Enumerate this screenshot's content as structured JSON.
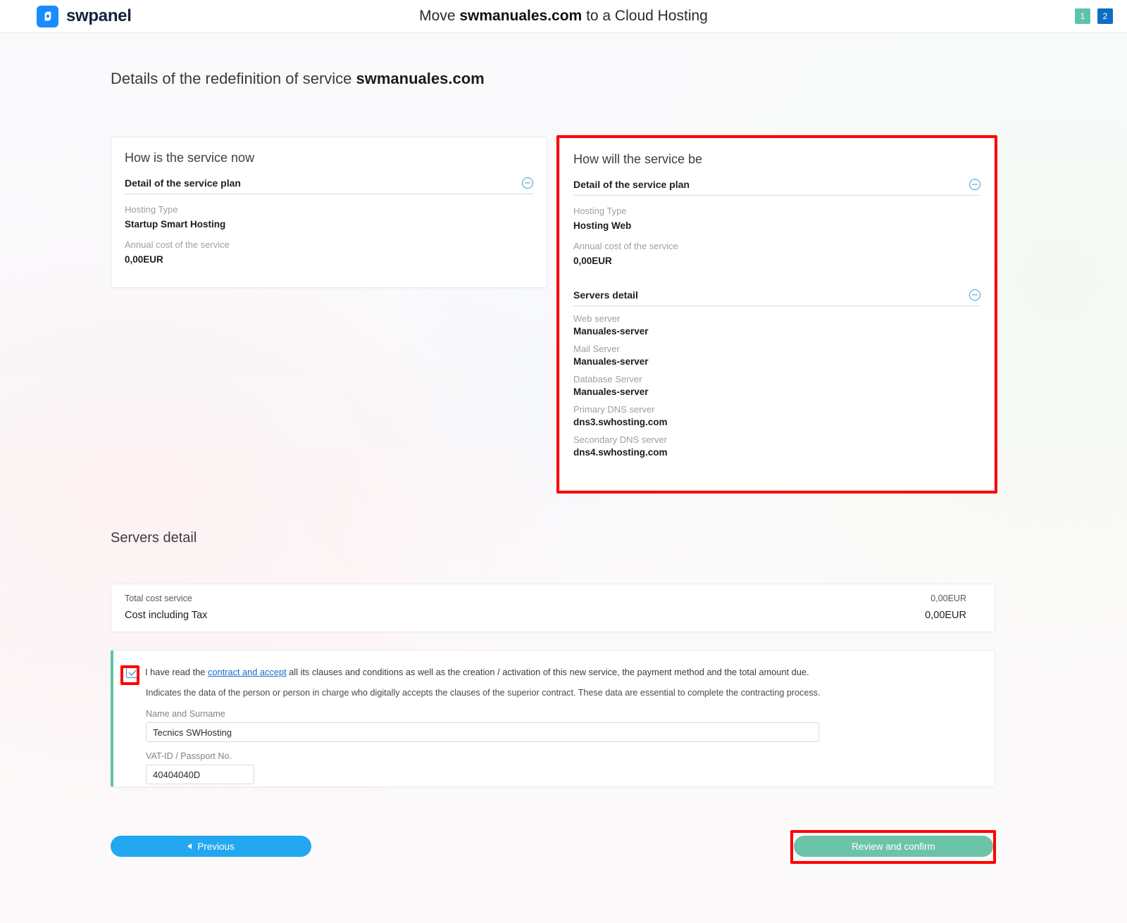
{
  "header": {
    "brand": "swpanel",
    "brand_icon": "swpanel-logo-icon",
    "title_prefix": "Move ",
    "title_domain": "swmanuales.com",
    "title_suffix": " to a Cloud Hosting",
    "steps": [
      {
        "label": "1",
        "state": "done",
        "color": "#5ec4a8"
      },
      {
        "label": "2",
        "state": "active",
        "color": "#0b6fc4"
      }
    ]
  },
  "page": {
    "title_prefix": "Details of the redefinition of service ",
    "title_domain": "swmanuales.com"
  },
  "service_now": {
    "heading": "How is the service now",
    "plan_section": {
      "title": "Detail of the service plan",
      "collapse_icon": "minus-circle-icon",
      "fields": [
        {
          "label": "Hosting Type",
          "value": "Startup Smart Hosting"
        },
        {
          "label": "Annual cost of the service",
          "value": "0,00EUR"
        }
      ]
    }
  },
  "service_next": {
    "heading": "How will the service be",
    "highlight_color": "#fe0000",
    "plan_section": {
      "title": "Detail of the service plan",
      "collapse_icon": "minus-circle-icon",
      "fields": [
        {
          "label": "Hosting Type",
          "value": "Hosting Web"
        },
        {
          "label": "Annual cost of the service",
          "value": "0,00EUR"
        }
      ]
    },
    "servers_section": {
      "title": "Servers detail",
      "collapse_icon": "minus-circle-icon",
      "fields": [
        {
          "label": "Web server",
          "value": "Manuales-server"
        },
        {
          "label": "Mail Server",
          "value": "Manuales-server"
        },
        {
          "label": "Database Server",
          "value": "Manuales-server"
        },
        {
          "label": "Primary DNS server",
          "value": "dns3.swhosting.com"
        },
        {
          "label": "Secondary DNS server",
          "value": "dns4.swhosting.com"
        }
      ]
    }
  },
  "servers_detail": {
    "heading": "Servers detail"
  },
  "cost": {
    "total_label": "Total cost service",
    "total_value": "0,00EUR",
    "tax_label": "Cost including Tax",
    "tax_value": "0,00EUR"
  },
  "contract": {
    "accent_color": "#5ec4a8",
    "checkbox_checked": true,
    "accept_text_before": "I have read the ",
    "accept_link": "contract and accept",
    "accept_text_after": " all its clauses and conditions as well as the creation / activation of this new service, the payment method and the total amount due.",
    "note": "Indicates the data of the person or person in charge who digitally accepts the clauses of the superior contract. These data are essential to complete the contracting process.",
    "name_label": "Name and Surname",
    "name_value": "Tecnics SWHosting",
    "vat_label": "VAT-ID / Passport No.",
    "vat_value": "40404040D"
  },
  "footer": {
    "previous_label": "Previous",
    "previous_icon": "chevron-left-icon",
    "previous_color": "#22a7f0",
    "confirm_label": "Review and confirm",
    "confirm_color": "#6cc4a8"
  }
}
